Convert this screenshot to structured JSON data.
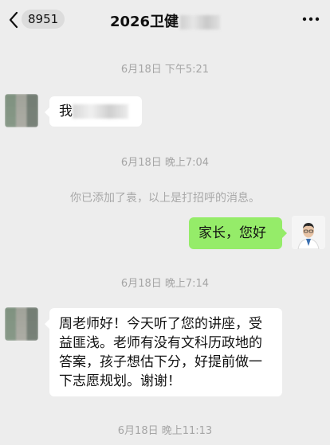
{
  "header": {
    "unread_badge": "8951",
    "title": "2026卫健",
    "back_icon": "chevron-left-icon",
    "more_icon": "more-horizontal-icon"
  },
  "messages": {
    "t1": "6月18日 下午5:21",
    "m1_text": "我",
    "t2": "6月18日 晚上7:04",
    "system_notice": "你已添加了袁，以上是打招呼的消息。",
    "m2_text": "家长，您好",
    "t3": "6月18日 晚上7:14",
    "m3_text": "周老师好！今天听了您的讲座，受益匪浅。老师有没有文科历政地的答案，孩子想估下分，好提前做一下志愿规划。谢谢！",
    "t4": "6月18日 晚上11:13"
  },
  "colors": {
    "background": "#ededed",
    "sent_bubble": "#95ec69",
    "received_bubble": "#ffffff",
    "timestamp": "#a5a5a5"
  }
}
